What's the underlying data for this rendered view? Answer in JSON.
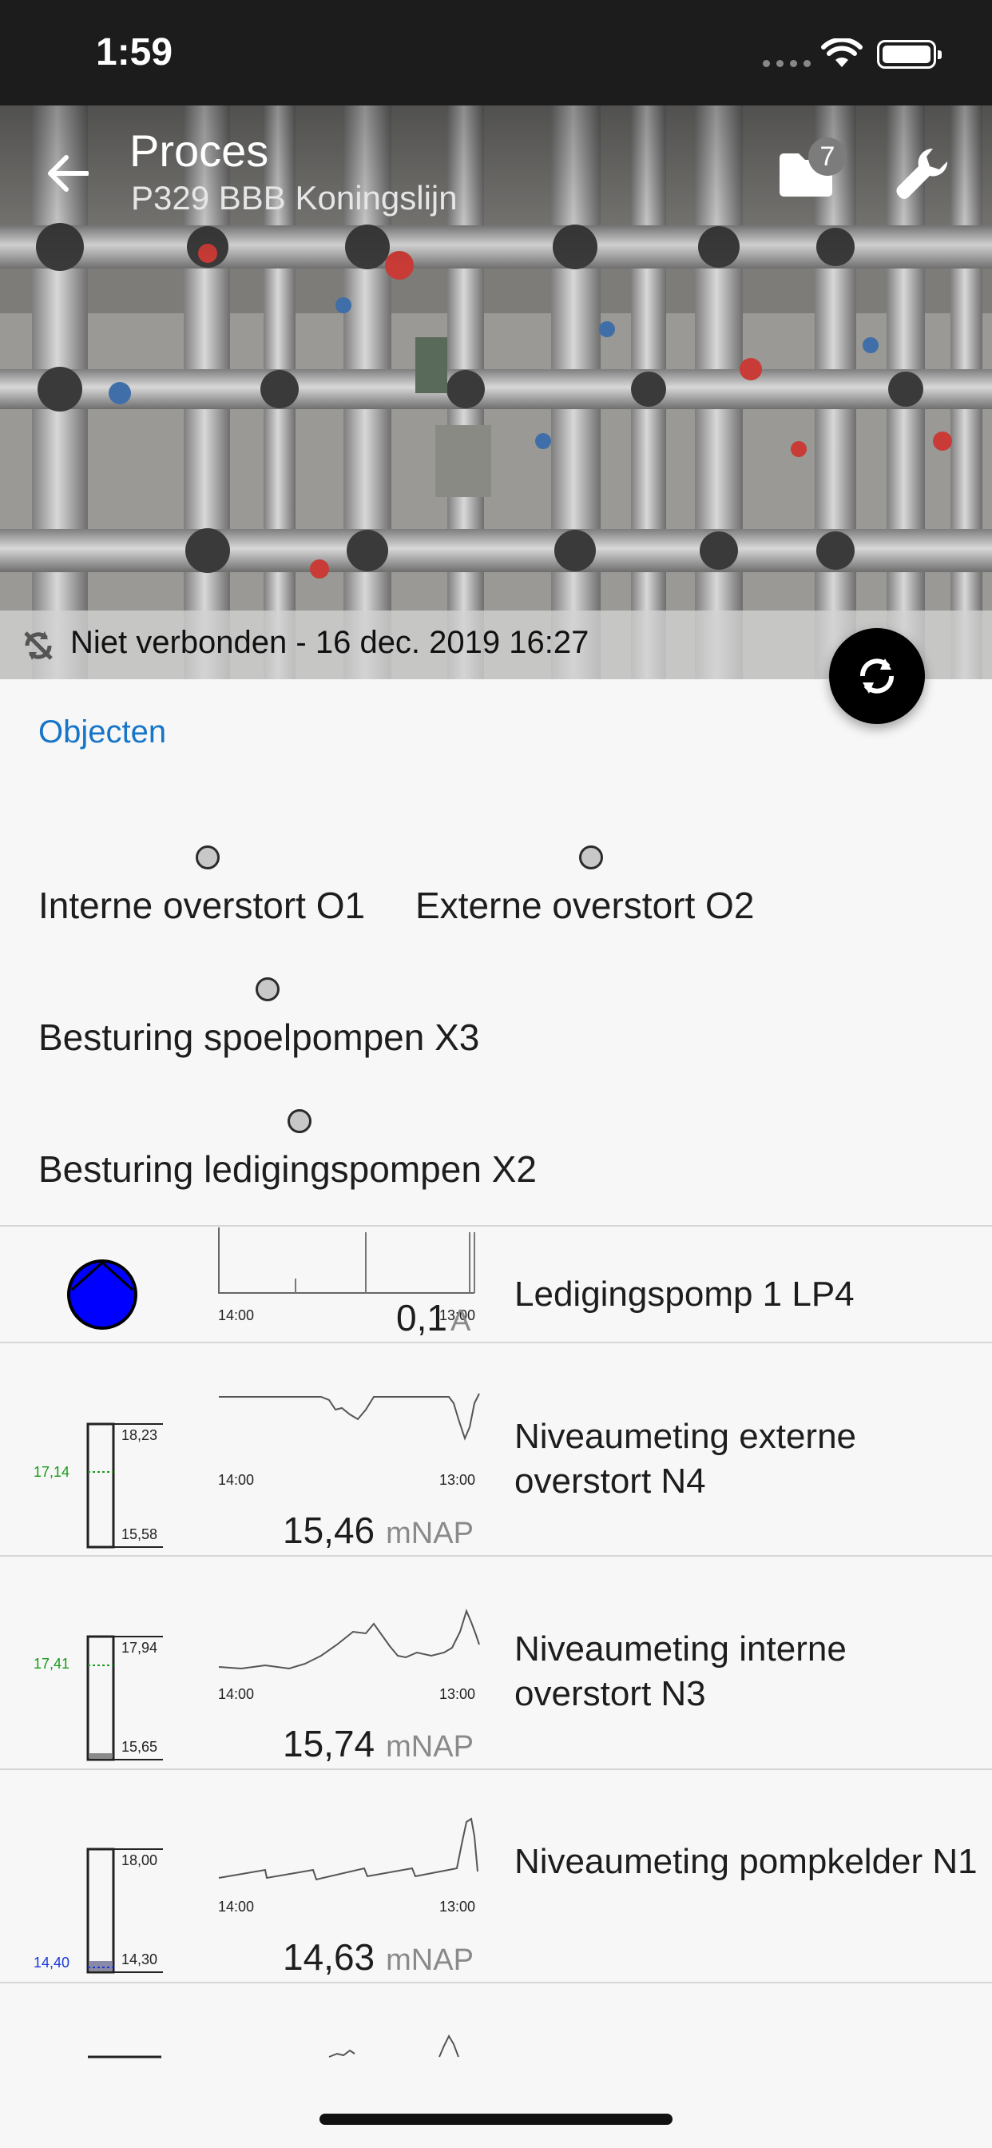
{
  "status_bar": {
    "time": "1:59"
  },
  "header": {
    "title": "Proces",
    "subtitle": "P329 BBB Koningslijn",
    "folder_badge": "7",
    "connection_status": "Niet verbonden - 16 dec. 2019 16:27"
  },
  "objects": {
    "section_title": "Objecten",
    "items": [
      {
        "label": "Interne overstort O1"
      },
      {
        "label": "Externe overstort O2"
      },
      {
        "label": "Besturing spoelpompen X3"
      },
      {
        "label": "Besturing ledigingspompen X2"
      }
    ]
  },
  "measurements": [
    {
      "label": "Ledigingspomp 1 LP4",
      "value": "0,1",
      "unit": "A",
      "time_start": "14:00",
      "time_end": "13:00"
    },
    {
      "label": "Niveaumeting externe overstort N4",
      "value": "15,46",
      "unit": "mNAP",
      "time_start": "14:00",
      "time_end": "13:00",
      "gauge_top": "18,23",
      "gauge_bottom": "15,58",
      "gauge_marker": "17,14",
      "gauge_fill": 0
    },
    {
      "label": "Niveaumeting interne overstort N3",
      "value": "15,74",
      "unit": "mNAP",
      "time_start": "14:00",
      "time_end": "13:00",
      "gauge_top": "17,94",
      "gauge_bottom": "15,65",
      "gauge_marker": "17,41",
      "gauge_fill": 0.04
    },
    {
      "label": "Niveaumeting pompkelder N1",
      "value": "14,63",
      "unit": "mNAP",
      "time_start": "14:00",
      "time_end": "13:00",
      "gauge_top": "18,00",
      "gauge_bottom": "14,30",
      "gauge_marker": "14,40",
      "gauge_fill": 0.09
    }
  ],
  "colors": {
    "accent": "#1775c7",
    "pump_on": "#0000ff",
    "marker_green": "#1a9a1a",
    "marker_blue": "#1a3ad8"
  }
}
